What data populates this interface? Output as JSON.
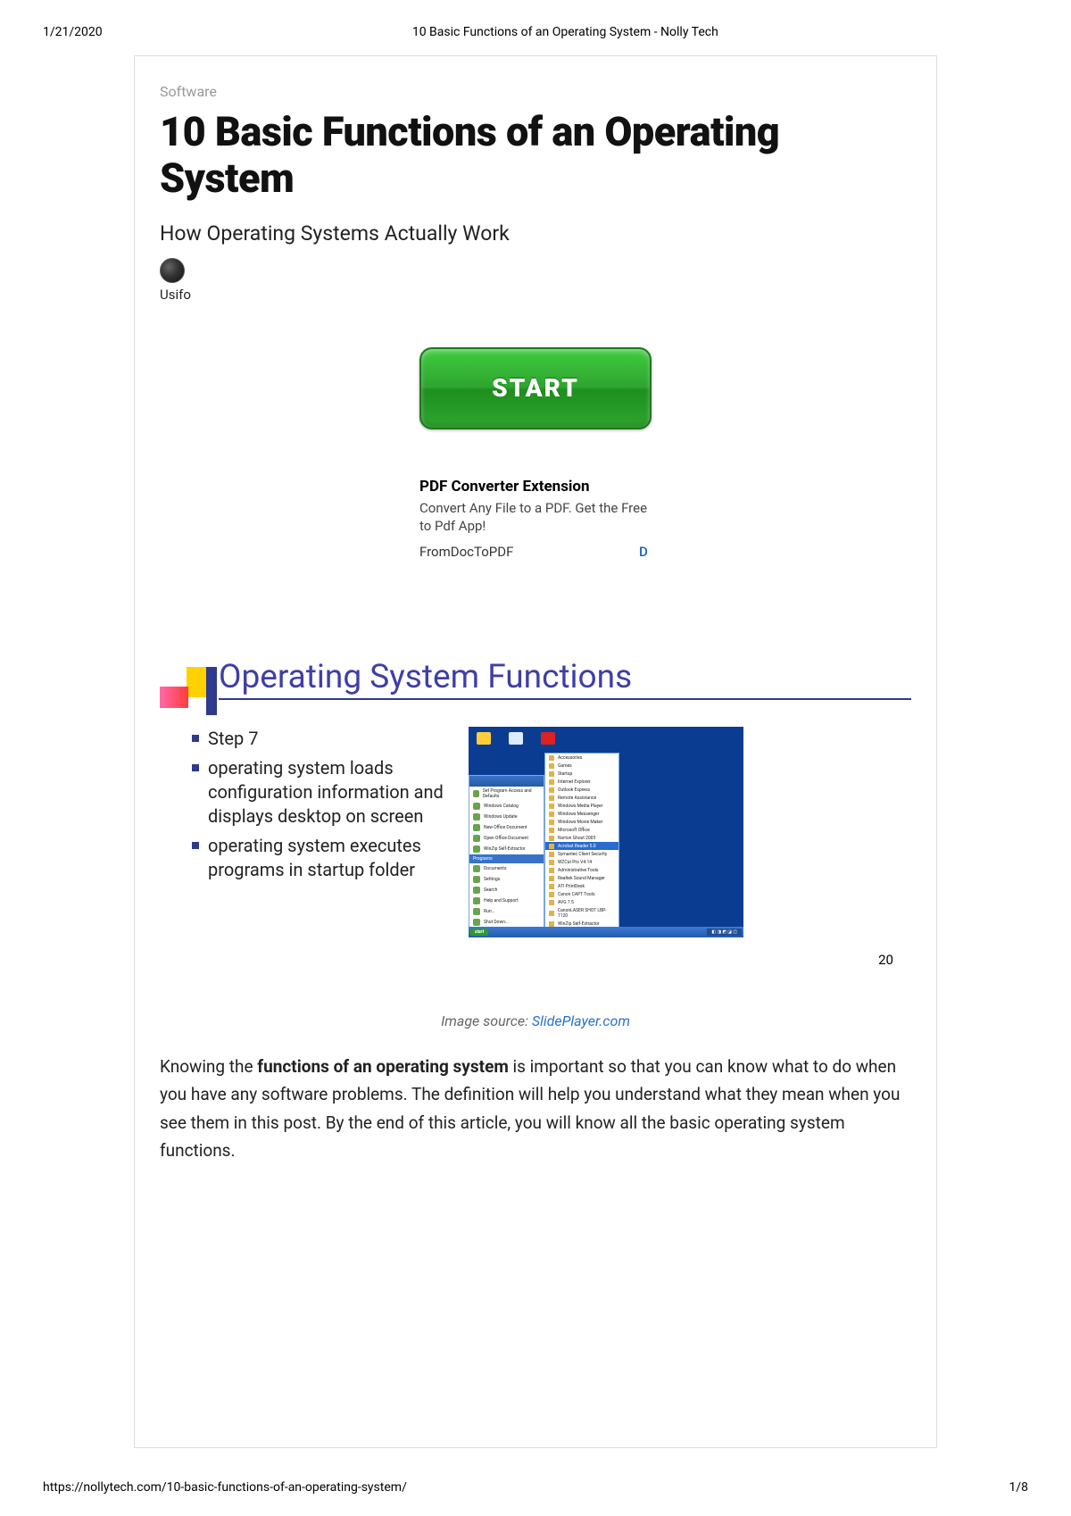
{
  "print": {
    "date": "1/21/2020",
    "header_title": "10 Basic Functions of an Operating System - Nolly Tech",
    "footer_url": "https://nollytech.com/10-basic-functions-of-an-operating-system/",
    "page": "1/8"
  },
  "article": {
    "category": "Software",
    "title": "10 Basic Functions of an Operating System",
    "subtitle": "How Operating Systems Actually Work",
    "author": "Usifo"
  },
  "ad": {
    "button_label": "START",
    "title": "PDF Converter Extension",
    "desc": "Convert Any File to a PDF. Get the Free to Pdf App!",
    "source": "FromDocToPDF",
    "cta": "D"
  },
  "slide": {
    "title": "Operating System Functions",
    "step": "Step 7",
    "bullet1": "operating system loads configuration information and displays desktop on screen",
    "bullet2": "operating system executes programs in startup folder",
    "screenshot": {
      "start_btn": "start",
      "menu_items": [
        "Set Program Access and Defaults",
        "Windows Catalog",
        "Windows Update",
        "New Office Document",
        "Open Office Document",
        "WinZip Self-Extractor",
        "Programs",
        "Documents",
        "Settings",
        "Search",
        "Help and Support",
        "Run...",
        "Shut Down..."
      ],
      "flyout_items": [
        "Accessories",
        "Games",
        "Startup",
        "Internet Explorer",
        "Outlook Express",
        "Remote Assistance",
        "Windows Media Player",
        "Windows Messenger",
        "Windows Movie Maker",
        "Microsoft Office",
        "Norton Ghost 2003",
        "Acrobat Reader 5.0",
        "Symantec Client Security",
        "WZCut Pro V4.14",
        "Administrative Tools",
        "Realtek Sound Manager",
        "ATI PrintDesk",
        "Canon CAPT Tools",
        "AVG 7.5",
        "CanonLASER SHOT LBP-1120",
        "WinZip Self-Extractor"
      ]
    },
    "page_num": "20"
  },
  "caption": {
    "prefix": "Image source: ",
    "link": "SlidePlayer.com"
  },
  "body": {
    "p1_a": "Knowing the ",
    "p1_b": "functions of an operating system",
    "p1_c": " is important so that you can know what to do when you have any software problems. The definition will help you understand what they mean when you see them in this post. By the end of this article, you will know all the basic operating system functions."
  }
}
